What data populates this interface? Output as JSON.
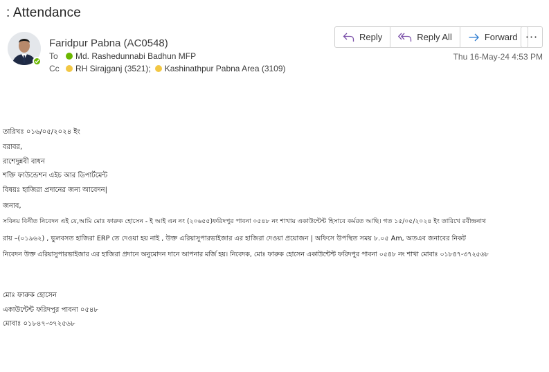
{
  "email": {
    "subject": ": Attendance",
    "sender": "Faridpur Pabna (AC0548)",
    "to_label": "To",
    "to": "Md. Rashedunnabi Badhun MFP",
    "cc_label": "Cc",
    "cc": [
      "RH Sirajganj (3521);",
      "Kashinathpur Pabna Area (3109)"
    ],
    "timestamp": "Thu 16-May-24 4:53 PM",
    "presence_color": "#6bb700"
  },
  "actions": {
    "reply": "Reply",
    "reply_all": "Reply All",
    "forward": "Forward",
    "more": "···",
    "accent_color": "#7a4fa8"
  },
  "body": {
    "date": "তারিখঃ ০১৬/০৫/২০২৪ ইং",
    "to_line": "বরাবর,",
    "recipient": "রাশেদুন্নবী বাধন",
    "org": "শক্তি ফাউন্ডেশন এইচ আর ডিপার্টমেন্ট",
    "subject": "বিষয়ঃ  হাজিরা প্রদানের জন্য আবেদন|",
    "salutation": "জনাব,",
    "para1": "সবিনয় বিনীত নিবেদন এই যে,আমি মোঃ ফারুক হোসেন - ই আই এন নং (২০৬৫৫)ফরিদপুর পাবনা ০৫৪৮ নং শাখায় একাউন্টেন্ট হিসাবে কর্মরত আছি। গত ১৫/০৫/২০২৪ ইং তারিখে  রবীন্দ্রনাথ",
    "para2": "রায়  –(০১৯৬২) , ভুলবসত হাজিরা  ERP তে দেওয়া হয় নাই ,  উক্ত  এরিয়াসুপারভাইজার  এর হাজিরা দেওয়া প্রয়োজন | অফিসে উপস্থিত সময় ৮.০৫ Am, অতএব জনাবের নিকট",
    "para3": "নিবেদন উক্ত  এরিয়াসুপারভাইজার এর হাজিরা প্রদানে  অনুমোদন দানে আপনার মর্জি হয়। নিবেদক, মোঃ ফারুক হোসেন একাউন্টেন্ট ফরিদপুর পাবনা ০৫৪৮ নং শাখা মোবাঃ ০১৮৪৭-৩৭২৫৬৮",
    "sign_name": "মোঃ ফারুক হোসেন",
    "sign_title": "একাউন্টেন্ট ফরিদপুর পাবনা ০৫৪৮",
    "sign_mobile": " মোবাঃ ০১৮৪৭-৩৭২৫৬৮"
  }
}
